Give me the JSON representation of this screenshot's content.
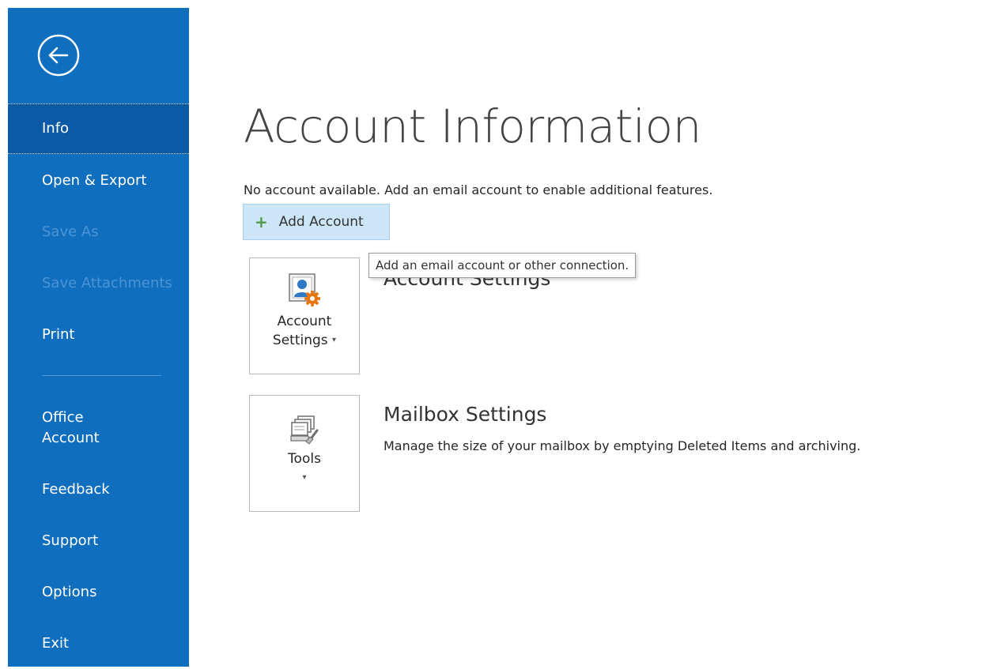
{
  "sidebar": {
    "back_icon": "back-arrow-circle-icon",
    "items": [
      {
        "label": "Info",
        "selected": true,
        "enabled": true
      },
      {
        "label": "Open & Export",
        "selected": false,
        "enabled": true
      },
      {
        "label": "Save As",
        "selected": false,
        "enabled": false
      },
      {
        "label": "Save Attachments",
        "selected": false,
        "enabled": false
      },
      {
        "label": "Print",
        "selected": false,
        "enabled": true
      },
      {
        "label": "Office Account",
        "selected": false,
        "enabled": true
      },
      {
        "label": "Feedback",
        "selected": false,
        "enabled": true
      },
      {
        "label": "Support",
        "selected": false,
        "enabled": true
      },
      {
        "label": "Options",
        "selected": false,
        "enabled": true
      },
      {
        "label": "Exit",
        "selected": false,
        "enabled": true
      }
    ]
  },
  "main": {
    "title": "Account Information",
    "notice": "No account available. Add an email account to enable additional features.",
    "add_account_label": "Add Account",
    "add_account_icon": "plus-icon",
    "tooltip": "Add an email account or other connection.",
    "account_settings": {
      "tile_line1": "Account",
      "tile_line2": "Settings",
      "heading": "Account Settings",
      "icon": "account-settings-icon"
    },
    "mailbox_settings": {
      "tile_label": "Tools",
      "heading": "Mailbox Settings",
      "description": "Manage the size of your mailbox by emptying Deleted Items and archiving.",
      "icon": "mailbox-cleanup-icon"
    }
  },
  "colors": {
    "sidebar_bg": "#106ebe",
    "sidebar_selected": "#0c5aa6",
    "disabled_text": "#4a94d6",
    "add_account_bg": "#cde6f7",
    "plus_green": "#4e9a4b",
    "gear_orange": "#e8740c"
  }
}
